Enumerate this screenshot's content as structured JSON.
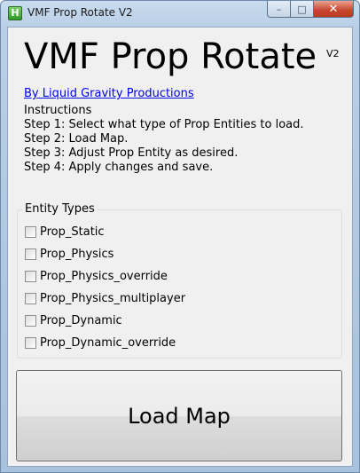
{
  "window": {
    "title": "VMF Prop Rotate V2",
    "icon": "app-h-icon",
    "icon_glyph": "H",
    "controls": {
      "minimize": "–",
      "maximize": "□",
      "close": "✕"
    }
  },
  "header": {
    "title": "VMF Prop Rotate",
    "version": "V2",
    "author_link": "By Liquid Gravity Productions"
  },
  "instructions": {
    "heading": "Instructions",
    "steps": [
      "Step 1: Select what type of Prop Entities to load.",
      "Step 2: Load Map.",
      "Step 3: Adjust Prop Entity as desired.",
      "Step 4: Apply changes and save."
    ]
  },
  "entity_types": {
    "legend": "Entity Types",
    "items": [
      {
        "label": "Prop_Static",
        "checked": false
      },
      {
        "label": "Prop_Physics",
        "checked": false
      },
      {
        "label": "Prop_Physics_override",
        "checked": false
      },
      {
        "label": "Prop_Physics_multiplayer",
        "checked": false
      },
      {
        "label": "Prop_Dynamic",
        "checked": false
      },
      {
        "label": "Prop_Dynamic_override",
        "checked": false
      }
    ]
  },
  "actions": {
    "load_map": "Load Map"
  }
}
